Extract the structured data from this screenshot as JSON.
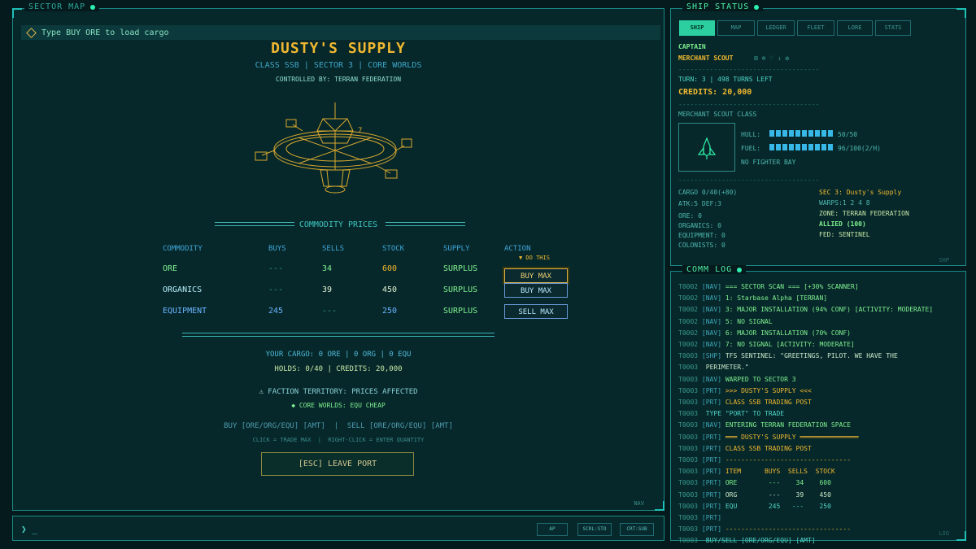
{
  "map": {
    "title": "SECTOR MAP",
    "hint": "Type BUY ORE to load cargo",
    "port_name": "DUSTY'S SUPPLY",
    "port_class": "CLASS SSB | SECTOR 3 | CORE WORLDS",
    "controlled_by": "CONTROLLED BY: TERRAN FEDERATION",
    "section_title": "COMMODITY PRICES",
    "headers": {
      "commodity": "COMMODITY",
      "buys": "BUYS",
      "sells": "SELLS",
      "stock": "STOCK",
      "supply": "SUPPLY",
      "action": "ACTION"
    },
    "do_this": "▼ DO THIS",
    "rows": [
      {
        "name": "ORE",
        "buys": "---",
        "sells": "34",
        "stock": "600",
        "supply": "SURPLUS",
        "action": "BUY MAX"
      },
      {
        "name": "ORGANICS",
        "buys": "---",
        "sells": "39",
        "stock": "450",
        "supply": "SURPLUS",
        "action": "BUY MAX"
      },
      {
        "name": "EQUIPMENT",
        "buys": "245",
        "sells": "---",
        "stock": "250",
        "supply": "SURPLUS",
        "action": "SELL MAX"
      }
    ],
    "your_cargo": "YOUR CARGO: 0 ORE | 0 ORG | 0 EQU",
    "holds": "HOLDS: 0/40 | CREDITS: 20,000",
    "faction_warning": "FACTION TERRITORY: PRICES AFFECTED",
    "faction_effect": "CORE WORLDS: EQU CHEAP",
    "usage": "BUY [ORE/ORG/EQU] [AMT]  |  SELL [ORE/ORG/EQU] [AMT]",
    "usage_hint": "CLICK = TRADE MAX  |  RIGHT-CLICK = ENTER QUANTITY",
    "leave_label": "[ESC] LEAVE PORT",
    "nav_tag": "NAV"
  },
  "cmd": {
    "prompt": "❯ _",
    "keys": [
      "AP",
      "SCRL:STO",
      "CRT:SUB"
    ]
  },
  "ship": {
    "title": "SHIP STATUS",
    "tabs": [
      "SHIP",
      "MAP",
      "LEDGER",
      "FLEET",
      "LORE",
      "STATS"
    ],
    "active_tab": "SHIP",
    "rank": "CAPTAIN",
    "ship_name": "MERCHANT SCOUT",
    "ship_icons": "⊞ ⊕ ♡ ⇂ ❂",
    "divider": "------------------------------------",
    "turn": "TURN: 3 | 498 TURNS LEFT",
    "credits": "CREDITS: 20,000",
    "class": "MERCHANT SCOUT CLASS",
    "hull_label": "HULL:",
    "hull_value": "50/50",
    "hull_fraction": 1.0,
    "fuel_label": "FUEL:",
    "fuel_value": "96/100(2/H)",
    "fuel_fraction": 0.96,
    "fighter": "NO FIGHTER BAY",
    "cargo": "CARGO 0/40(+80)",
    "atk_def": "ATK:5 DEF:3",
    "ore": "ORE: 0",
    "organics": "ORGANICS: 0",
    "equipment": "EQUIPMENT: 0",
    "colonists": "COLONISTS: 0",
    "sector": "SEC 3: Dusty's Supply",
    "warps": "WARPS:1 2 4 8",
    "zone": "ZONE: TERRAN FEDERATION",
    "allied": "ALLIED (100)",
    "fed": "FED: SENTINEL",
    "tag": "SHP"
  },
  "log": {
    "title": "COMM LOG",
    "tag": "LOG",
    "lines": [
      {
        "t": "T0002",
        "tag": "[NAV]",
        "msg": "=== SECTOR SCAN === [+30% SCANNER]",
        "c": "g"
      },
      {
        "t": "T0002",
        "tag": "[NAV]",
        "msg": "1: Starbase Alpha [TERRAN]",
        "c": "g"
      },
      {
        "t": "T0002",
        "tag": "[NAV]",
        "msg": "3: MAJOR INSTALLATION (94% CONF) [ACTIVITY: MODERATE]",
        "c": "g"
      },
      {
        "t": "T0002",
        "tag": "[NAV]",
        "msg": "5: NO SIGNAL",
        "c": "g"
      },
      {
        "t": "T0002",
        "tag": "[NAV]",
        "msg": "6: MAJOR INSTALLATION (70% CONF)",
        "c": "g"
      },
      {
        "t": "T0002",
        "tag": "[NAV]",
        "msg": "7: NO SIGNAL [ACTIVITY: MODERATE]",
        "c": "g"
      },
      {
        "t": "T0003",
        "tag": "[SHP]",
        "msg": "TFS SENTINEL: \"GREETINGS, PILOT. WE HAVE THE",
        "c": "w"
      },
      {
        "t": "T0003",
        "tag": "",
        "msg": "PERIMETER.\"",
        "c": "w"
      },
      {
        "t": "T0003",
        "tag": "[NAV]",
        "msg": "WARPED TO SECTOR 3",
        "c": "g"
      },
      {
        "t": "T0003",
        "tag": "[PRT]",
        "msg": ">>> DUSTY'S SUPPLY <<<",
        "c": "y"
      },
      {
        "t": "T0003",
        "tag": "[PRT]",
        "msg": "CLASS SSB TRADING POST",
        "c": "y"
      },
      {
        "t": "T0003",
        "tag": "",
        "msg": "TYPE \"PORT\" TO TRADE",
        "c": "c"
      },
      {
        "t": "T0003",
        "tag": "[NAV]",
        "msg": "ENTERING TERRAN FEDERATION SPACE",
        "c": "g"
      },
      {
        "t": "T0003",
        "tag": "[PRT]",
        "msg": "═══ DUSTY'S SUPPLY ═══════════════",
        "c": "y"
      },
      {
        "t": "T0003",
        "tag": "[PRT]",
        "msg": "CLASS SSB TRADING POST",
        "c": "y"
      },
      {
        "t": "T0003",
        "tag": "[PRT]",
        "msg": "--------------------------------",
        "c": "y"
      },
      {
        "t": "T0003",
        "tag": "[PRT]",
        "msg": "ITEM      BUYS  SELLS  STOCK",
        "c": "y"
      },
      {
        "t": "T0003",
        "tag": "[PRT]",
        "msg": "ORE        ---    34    600",
        "c": "g"
      },
      {
        "t": "T0003",
        "tag": "[PRT]",
        "msg": "ORG        ---    39    450",
        "c": "w"
      },
      {
        "t": "T0003",
        "tag": "[PRT]",
        "msg": "EQU        245   ---    250",
        "c": "c"
      },
      {
        "t": "T0003",
        "tag": "[PRT]",
        "msg": "",
        "c": "y"
      },
      {
        "t": "T0003",
        "tag": "[PRT]",
        "msg": "--------------------------------",
        "c": "y"
      },
      {
        "t": "T0003",
        "tag": "",
        "msg": "BUY/SELL [ORE/ORG/EQU] [AMT]",
        "c": "c"
      }
    ]
  }
}
